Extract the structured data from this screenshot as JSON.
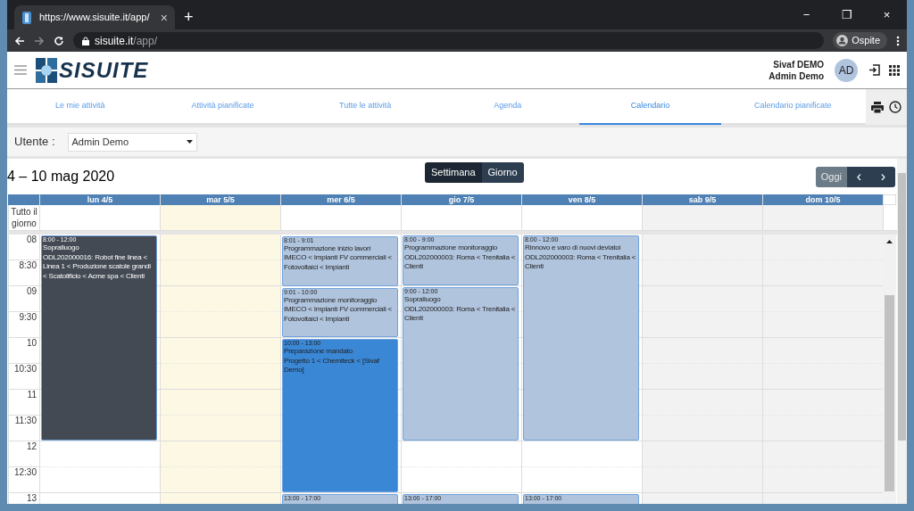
{
  "browser": {
    "tab_title": "https://www.sisuite.it/app/",
    "tab_close": "×",
    "new_tab": "+",
    "window_controls": [
      "−",
      "❐",
      "×"
    ],
    "url_host": "sisuite.it",
    "url_path": "/app/",
    "profile": "Ospite"
  },
  "header": {
    "logo": "SISUITE",
    "company": "Sivaf DEMO",
    "user": "Admin Demo",
    "avatar": "AD"
  },
  "tabs": [
    {
      "label": "Le mie attività",
      "selected": false
    },
    {
      "label": "Attività pianificate",
      "selected": false
    },
    {
      "label": "Tutte le attività",
      "selected": false
    },
    {
      "label": "Agenda",
      "selected": false
    },
    {
      "label": "Calendario",
      "selected": true
    },
    {
      "label": "Calendario pianificate",
      "selected": false
    }
  ],
  "filter": {
    "label": "Utente :",
    "value": "Admin Demo"
  },
  "calendar": {
    "title": "4 – 10 mag 2020",
    "views": [
      {
        "label": "Settimana",
        "selected": true
      },
      {
        "label": "Giorno",
        "selected": false
      }
    ],
    "today_button": {
      "label": "Oggi",
      "disabled": true
    },
    "prev": "‹",
    "next": "›",
    "all_day_label": "Tutto il giorno",
    "times": [
      "08",
      "8:30",
      "09",
      "9:30",
      "10",
      "10:30",
      "11",
      "11:30",
      "12",
      "12:30",
      "13"
    ],
    "days": [
      {
        "label": "lun 4/5",
        "kind": "weekday",
        "events": [
          {
            "time": "8:00 - 12:00",
            "title": "Sopralluogo",
            "detail": "ODL202000016: Robot fine linea < Linea 1 < Produzione scatole grandi < Scatolificio < Acme spa < Clienti",
            "color": "#434a54"
          }
        ]
      },
      {
        "label": "mar 5/5",
        "kind": "today"
      },
      {
        "label": "mer 6/5",
        "kind": "weekday",
        "events": [
          {
            "time": "8:01 - 9:01",
            "title": "Programmazione inizio lavori",
            "detail": "IMECO < Impianti FV commerciali < Fotovoltaici < Impianti",
            "color": "#b0c4de"
          },
          {
            "time": "9:01 - 10:00",
            "title": "Programmazione monitoraggio",
            "detail": "IMECO < Impianti FV commerciali < Fotovoltaici < Impianti",
            "color": "#b0c4de"
          },
          {
            "time": "10:00 - 13:00",
            "title": "Preparazione mandato",
            "detail": "Progetto 1 < Chemiteck < [Sivaf Demo]",
            "color": "#3a87d6"
          },
          {
            "time": "13:00 - 17:00",
            "color": "#b0c4de"
          }
        ]
      },
      {
        "label": "gio 7/5",
        "kind": "weekday",
        "events": [
          {
            "time": "8:00 - 9:00",
            "title": "Programmazione monitoraggio",
            "detail": "ODL202000003: Roma < Trenitalia < Clienti",
            "color": "#b0c4de"
          },
          {
            "time": "9:00 - 12:00",
            "title": "Sopralluogo",
            "detail": "ODL202000003: Roma < Trenitalia < Clienti",
            "color": "#b0c4de"
          },
          {
            "time": "13:00 - 17:00",
            "color": "#b0c4de"
          }
        ]
      },
      {
        "label": "ven 8/5",
        "kind": "weekday",
        "events": [
          {
            "time": "8:00 - 12:00",
            "title": "Rinnovo e varo di nuovi deviatoi",
            "detail": "ODL202000003: Roma < Trenitalia < Clienti",
            "color": "#b0c4de"
          },
          {
            "time": "13:00 - 17:00",
            "color": "#b0c4de"
          }
        ]
      },
      {
        "label": "sab 9/5",
        "kind": "weekend"
      },
      {
        "label": "dom 10/5",
        "kind": "weekend"
      }
    ]
  }
}
